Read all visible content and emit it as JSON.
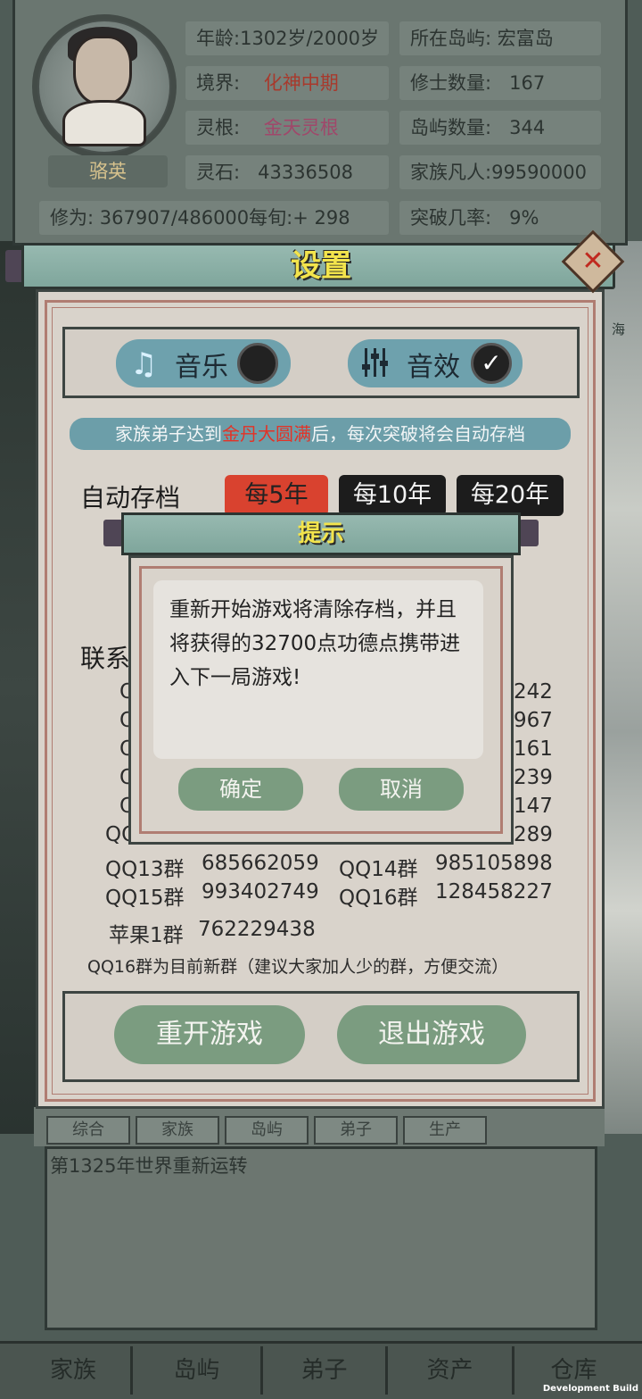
{
  "status": {
    "name": "骆英",
    "rows": [
      {
        "label": "年龄:",
        "value": "1302岁/2000岁",
        "label2": "所在岛屿:",
        "value2": "宏富岛"
      },
      {
        "label": "境界:",
        "value": "化神中期",
        "label2": "修士数量:",
        "value2": "167"
      },
      {
        "label": "灵根:",
        "value": "金天灵根",
        "label2": "岛屿数量:",
        "value2": "344"
      },
      {
        "label": "灵石:",
        "value": "43336508",
        "label2": "家族凡人:",
        "value2": "99590000"
      }
    ],
    "cultivation": "修为: 367907/486000每旬:+ 298",
    "breakthrough_label": "突破几率:",
    "breakthrough_value": "9%"
  },
  "background": {
    "edge_label": "海",
    "tabs": [
      "综合",
      "家族",
      "岛屿",
      "弟子",
      "生产"
    ],
    "log": [
      "第1325年世界重新运转"
    ],
    "nav": [
      "家族",
      "岛屿",
      "弟子",
      "资产",
      "仓库"
    ],
    "dev_build": "Development Build"
  },
  "settings": {
    "title": "设置",
    "music_label": "音乐",
    "sfx_label": "音效",
    "music_on": false,
    "sfx_on": true,
    "save_hint_pre": "家族弟子达到",
    "save_hint_hl": "金丹大圆满",
    "save_hint_post": "后，每次突破将会自动存档",
    "autosave_label": "自动存档",
    "autosave_options": [
      "每5年",
      "每10年",
      "每20年"
    ],
    "autosave_selected": 0,
    "contact_label": "联系",
    "qq_partial_right": [
      "242",
      "967",
      "161",
      "239",
      "147",
      "289"
    ],
    "qq_partial_left": [
      "QQ",
      "Q",
      "Q",
      "Q",
      "Q",
      "QQ"
    ],
    "qq_groups": [
      {
        "name": "QQ13群",
        "number": "685662059"
      },
      {
        "name": "QQ14群",
        "number": "985105898"
      },
      {
        "name": "QQ15群",
        "number": "993402749"
      },
      {
        "name": "QQ16群",
        "number": "128458227"
      },
      {
        "name": "苹果1群",
        "number": "762229438"
      }
    ],
    "new_group_note": "QQ16群为目前新群（建议大家加人少的群，方便交流）",
    "restart_label": "重开游戏",
    "quit_label": "退出游戏"
  },
  "prompt": {
    "title": "提示",
    "message": "重新开始游戏将清除存档，并且将获得的32700点功德点携带进入下一局游戏!",
    "confirm_label": "确定",
    "cancel_label": "取消"
  },
  "colors": {
    "title_yellow": "#f3e44c",
    "button_green": "#7b9c80",
    "hint_blue": "#6c9ea9",
    "highlight_red": "#e43226"
  }
}
